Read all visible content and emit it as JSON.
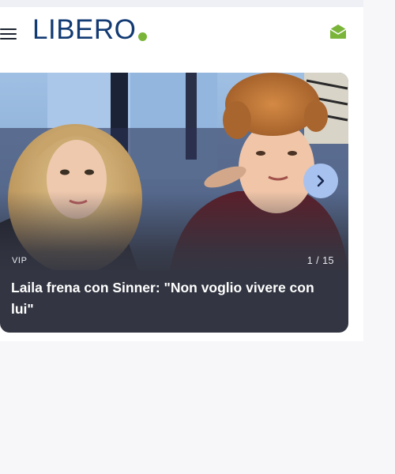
{
  "header": {
    "logo_text": "LIBERO",
    "menu_icon": "hamburger-menu-icon",
    "mail_icon": "mail-icon"
  },
  "colors": {
    "brand_blue": "#123a73",
    "brand_green": "#7ab53a",
    "card_background": "#333642",
    "next_button": "#a8c2ef"
  },
  "slideshow": {
    "category": "VIP",
    "counter": "1 / 15",
    "headline": "Laila frena con Sinner: \"Non voglio vivere con lui\"",
    "next_icon": "chevron-right-icon"
  }
}
